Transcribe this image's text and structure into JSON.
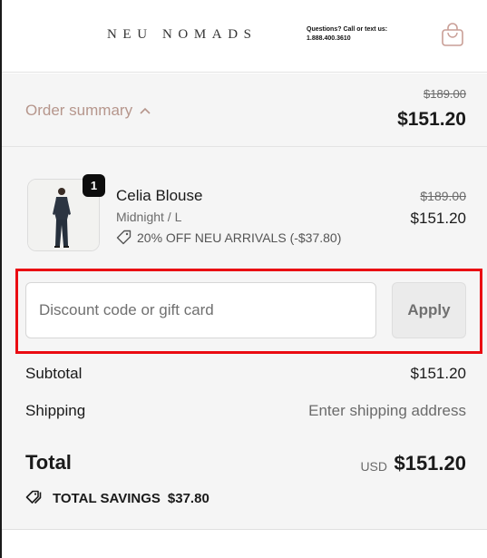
{
  "header": {
    "brand": "NEU NOMADS",
    "contact_line1": "Questions?  Call or text us:",
    "contact_line2": "1.888.400.3610",
    "bag_icon": "shopping-bag-icon"
  },
  "summary": {
    "toggle_label": "Order summary",
    "toggle_icon": "chevron-up-icon",
    "original_total": "$189.00",
    "total": "$151.20"
  },
  "item": {
    "quantity": "1",
    "name": "Celia Blouse",
    "variant": "Midnight / L",
    "discount_icon": "tag-icon",
    "discount_label": "20% OFF NEU ARRIVALS (-$37.80)",
    "original_price": "$189.00",
    "price": "$151.20"
  },
  "discount": {
    "placeholder": "Discount code or gift card",
    "value": "",
    "apply_label": "Apply"
  },
  "totals": {
    "subtotal_label": "Subtotal",
    "subtotal_value": "$151.20",
    "shipping_label": "Shipping",
    "shipping_value": "Enter shipping address",
    "total_label": "Total",
    "currency": "USD",
    "total_value": "$151.20",
    "savings_icon": "tags-icon",
    "savings_label": "TOTAL SAVINGS",
    "savings_value": "$37.80"
  },
  "colors": {
    "accent_summary": "#b6968c",
    "highlight_border": "#ea0b12",
    "summary_background": "#f5f5f5"
  }
}
